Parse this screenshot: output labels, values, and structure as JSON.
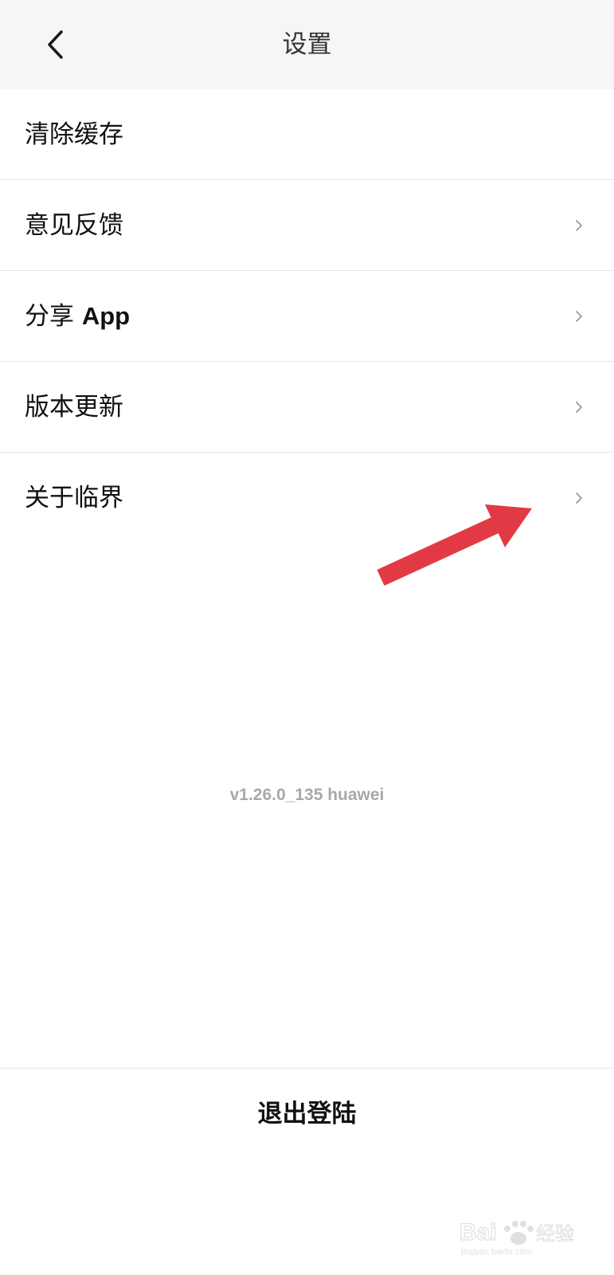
{
  "header": {
    "title": "设置",
    "back_icon": "chevron-left-icon"
  },
  "menu": {
    "items": [
      {
        "label": "清除缓存",
        "bold_suffix": "",
        "has_chevron": false
      },
      {
        "label": "意见反馈",
        "bold_suffix": "",
        "has_chevron": true
      },
      {
        "label": "分享 ",
        "bold_suffix": "App",
        "has_chevron": true
      },
      {
        "label": "版本更新",
        "bold_suffix": "",
        "has_chevron": true
      },
      {
        "label": "关于临界",
        "bold_suffix": "",
        "has_chevron": true
      }
    ]
  },
  "version_text": "v1.26.0_135 huawei",
  "logout_label": "退出登陆",
  "annotation": {
    "arrow_color": "#e23a44"
  },
  "watermark": {
    "brand": "Baidu经验",
    "url": "jingyan.baidu.com"
  }
}
